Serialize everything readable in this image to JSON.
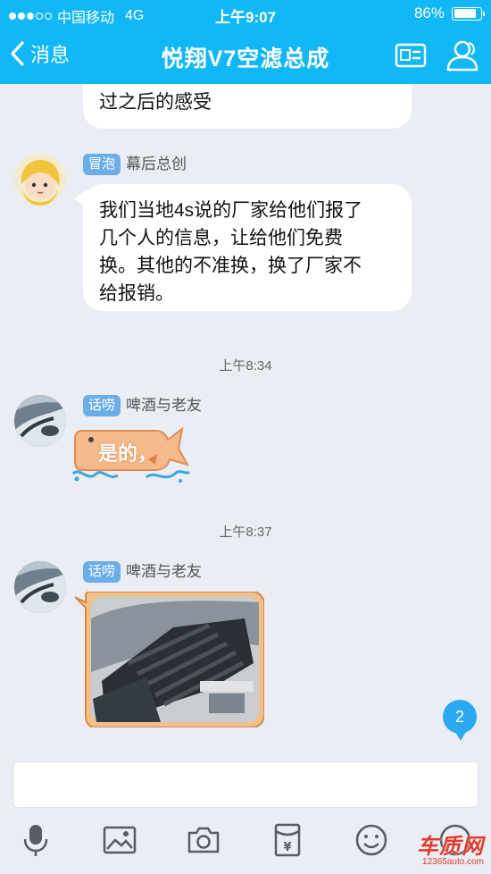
{
  "status_bar": {
    "carrier": "中国移动",
    "network": "4G",
    "time": "上午9:07",
    "battery": "86%",
    "battery_level": 0.86
  },
  "nav": {
    "back_label": "消息",
    "title": "悦翔V7空滤总成"
  },
  "messages": [
    {
      "partial_text": "过之后的感受"
    },
    {
      "badge": "冒泡",
      "sender": "幕后总创",
      "lines": [
        "我们当地4s说的厂家给他们报了",
        "几个人的信息，让给他们免费",
        "换。其他的不准换，换了厂家不",
        "给报销。"
      ]
    },
    {
      "timestamp": "上午8:34"
    },
    {
      "badge": "话唠",
      "sender": "啤酒与老友",
      "text": "是的，"
    },
    {
      "timestamp": "上午8:37"
    },
    {
      "badge": "话唠",
      "sender": "啤酒与老友",
      "image": "air-filter-photo"
    }
  ],
  "unread_count": "2",
  "toolbar": {
    "icons": [
      "microphone-icon",
      "image-icon",
      "camera-icon",
      "red-packet-icon",
      "emoji-icon",
      "more-icon"
    ]
  },
  "watermark": {
    "brand": "车质网",
    "url": "12365auto.com"
  },
  "colors": {
    "header": "#12b7f5",
    "background": "#eaedf3",
    "badge": "#6aaee8",
    "unread": "#2aa8f0"
  }
}
